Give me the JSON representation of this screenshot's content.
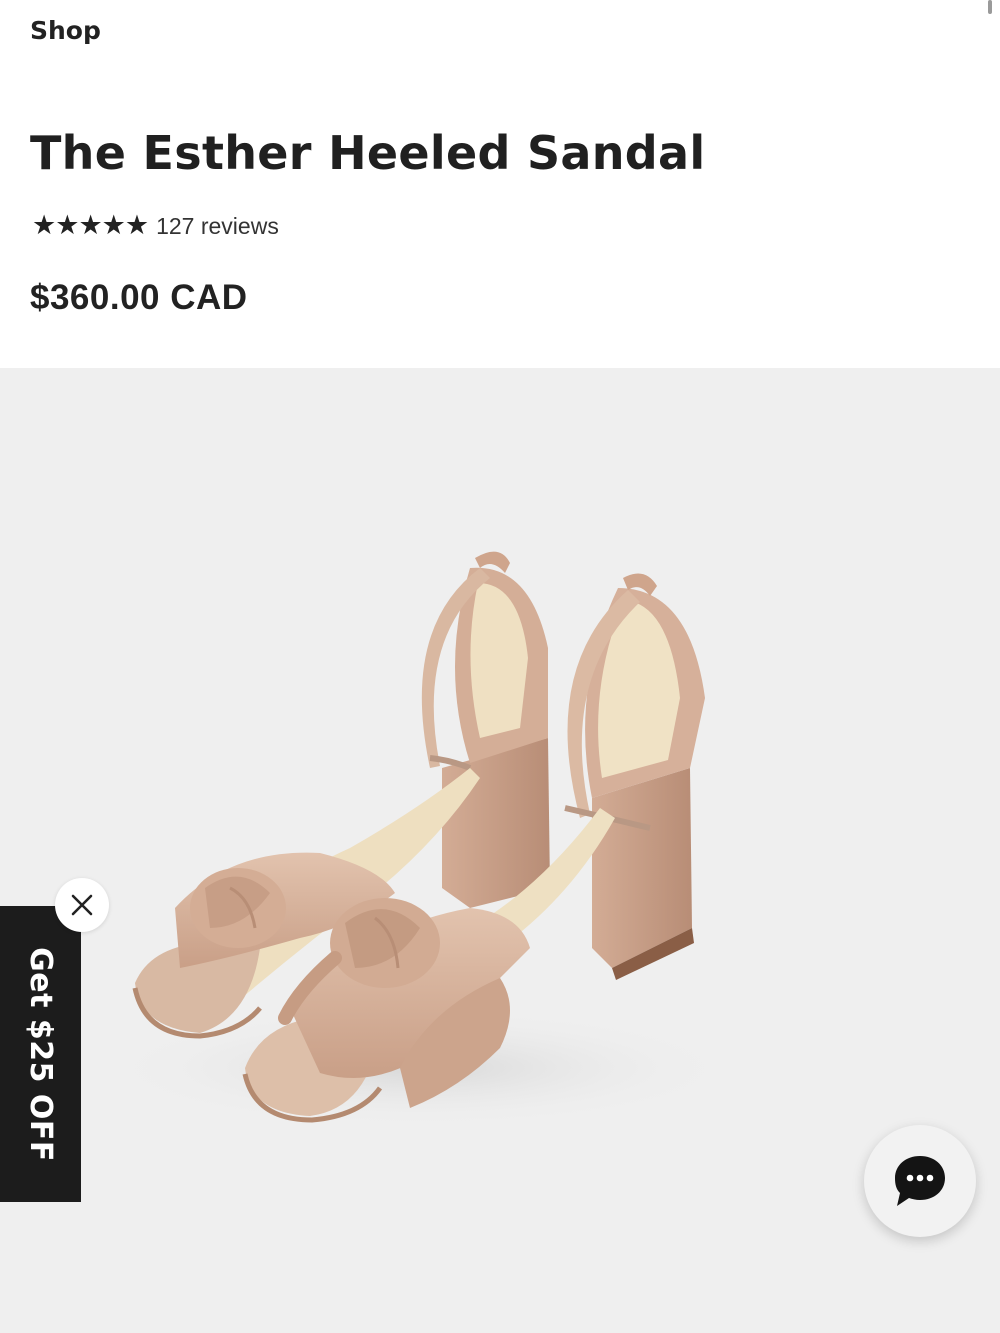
{
  "header": {
    "breadcrumb": "Shop"
  },
  "product": {
    "title": "The Esther Heeled Sandal",
    "rating_stars": 5,
    "reviews_label": "127 reviews",
    "price": "$360.00 CAD",
    "image_icon": "product-photo"
  },
  "promo": {
    "label": "Get $25 OFF",
    "close_icon": "close-icon"
  },
  "chat": {
    "icon": "chat-bubble-icon"
  },
  "colors": {
    "accent_dark": "#1c1c1c",
    "image_background": "#efefef",
    "sandal": "#d6b39f"
  }
}
